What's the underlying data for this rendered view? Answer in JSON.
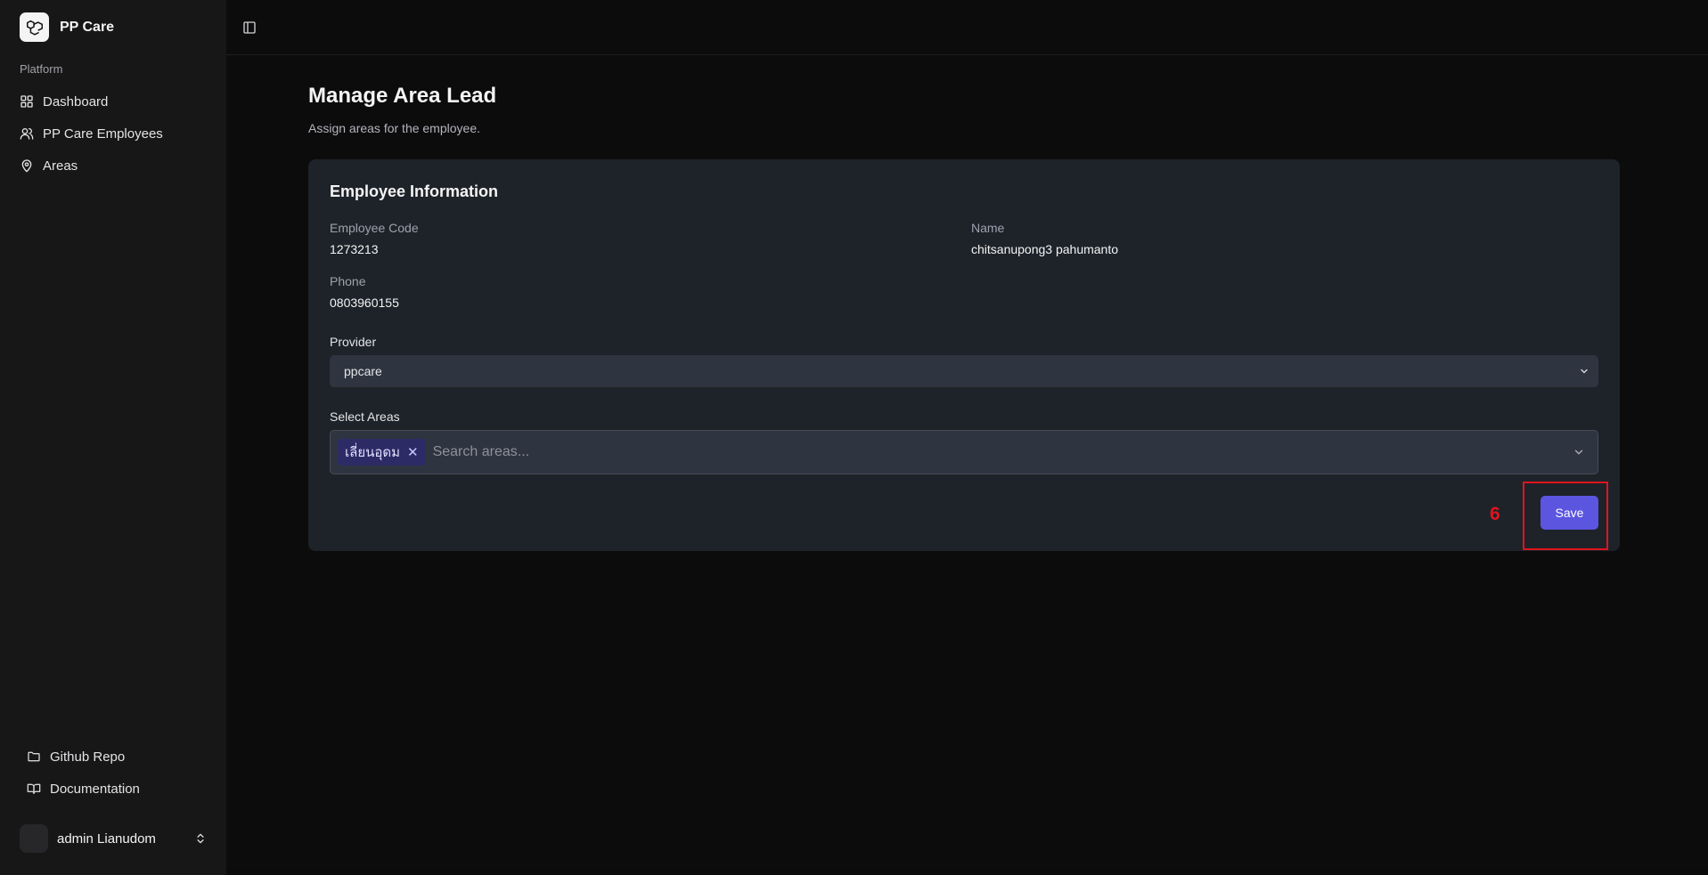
{
  "app": {
    "name": "PP Care"
  },
  "sidebar": {
    "section_label": "Platform",
    "items": [
      {
        "label": "Dashboard",
        "icon": "grid-icon"
      },
      {
        "label": "PP Care Employees",
        "icon": "users-icon"
      },
      {
        "label": "Areas",
        "icon": "map-pin-icon"
      }
    ],
    "bottom_items": [
      {
        "label": "Github Repo",
        "icon": "folder-icon"
      },
      {
        "label": "Documentation",
        "icon": "book-icon"
      }
    ],
    "user": {
      "name": "admin Lianudom"
    }
  },
  "page": {
    "title": "Manage Area Lead",
    "subtitle": "Assign areas for the employee."
  },
  "card": {
    "title": "Employee Information",
    "employee_code": {
      "label": "Employee Code",
      "value": "1273213"
    },
    "name": {
      "label": "Name",
      "value": "chitsanupong3 pahumanto"
    },
    "phone": {
      "label": "Phone",
      "value": "0803960155"
    },
    "provider": {
      "label": "Provider",
      "value": "ppcare"
    },
    "areas": {
      "label": "Select Areas",
      "selected": [
        "เลี่ยนอุดม"
      ],
      "placeholder": "Search areas..."
    },
    "save_label": "Save"
  },
  "annotation": {
    "number": "6",
    "color": "#e0141e"
  },
  "colors": {
    "accent": "#5b55e0",
    "tag_bg": "#2d2b66",
    "card_bg": "#1e2329"
  }
}
